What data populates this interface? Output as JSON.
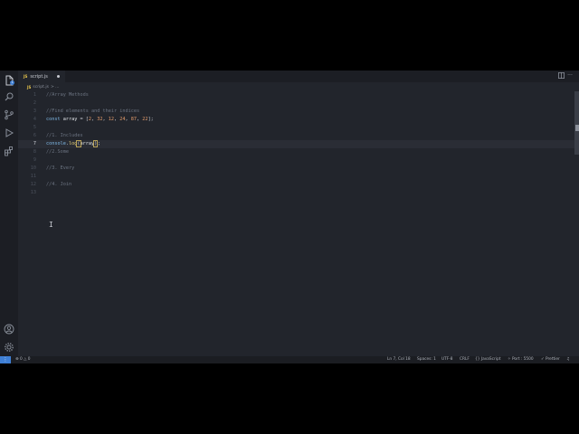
{
  "tab": {
    "filename": "script.js",
    "file_icon": "JS",
    "modified": true
  },
  "breadcrumb": {
    "file_icon": "JS",
    "file": "script.js",
    "trail": "> ..."
  },
  "editor": {
    "current_line": 7,
    "lines": [
      {
        "n": "1",
        "text": "//Array Methods"
      },
      {
        "n": "2",
        "text": ""
      },
      {
        "n": "3",
        "text": "//Find elements and their indices"
      },
      {
        "n": "4",
        "text": "const array = [2, 32, 12, 24, 87, 22];"
      },
      {
        "n": "5",
        "text": ""
      },
      {
        "n": "6",
        "text": "//1. Includes"
      },
      {
        "n": "7",
        "text": "console.log(array);"
      },
      {
        "n": "8",
        "text": "//2.Some"
      },
      {
        "n": "9",
        "text": ""
      },
      {
        "n": "10",
        "text": "//3. Every"
      },
      {
        "n": "11",
        "text": ""
      },
      {
        "n": "12",
        "text": "//4. Join"
      },
      {
        "n": "13",
        "text": ""
      }
    ]
  },
  "activity_bar": {
    "top": [
      "files-icon",
      "search-icon",
      "source-control-icon",
      "run-debug-icon",
      "extensions-icon"
    ],
    "bottom": [
      "account-icon",
      "settings-gear-icon"
    ],
    "explorer_badge": "1"
  },
  "status": {
    "remote_icon": "remote-icon",
    "errors": "0",
    "warnings": "0",
    "position": "Ln 7, Col 18",
    "spaces": "Spaces: 1",
    "encoding": "UTF-8",
    "eol": "CRLF",
    "language": "JavaScript",
    "port": "Port : 5500",
    "prettier": "Prettier"
  },
  "colors": {
    "editor_bg": "#22252c",
    "accent": "#3f7fd4",
    "keyword": "#7fb8e6",
    "number": "#e39b6a",
    "function": "#e6d27a",
    "comment": "#6b7380"
  }
}
